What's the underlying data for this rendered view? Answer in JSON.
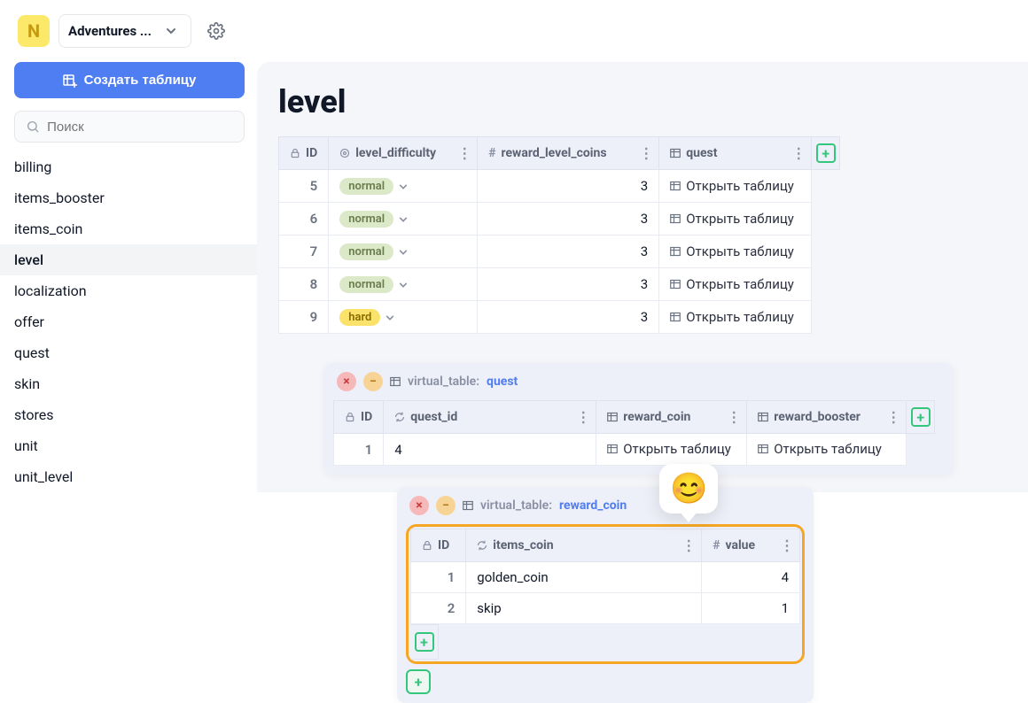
{
  "project_name": "Adventures ...",
  "create_button": "Создать таблицу",
  "search_placeholder": "Поиск",
  "sidebar_items": [
    "billing",
    "items_booster",
    "items_coin",
    "level",
    "localization",
    "offer",
    "quest",
    "skin",
    "stores",
    "unit",
    "unit_level"
  ],
  "active_sidebar": "level",
  "page_title": "level",
  "main_table": {
    "headers": {
      "id": "ID",
      "difficulty": "level_difficulty",
      "coins": "reward_level_coins",
      "quest": "quest"
    },
    "open_table_label": "Открыть таблицу",
    "rows": [
      {
        "id": "5",
        "difficulty": "normal",
        "diff_class": "normal",
        "coins": "3"
      },
      {
        "id": "6",
        "difficulty": "normal",
        "diff_class": "normal",
        "coins": "3"
      },
      {
        "id": "7",
        "difficulty": "normal",
        "diff_class": "normal",
        "coins": "3"
      },
      {
        "id": "8",
        "difficulty": "normal",
        "diff_class": "normal",
        "coins": "3"
      },
      {
        "id": "9",
        "difficulty": "hard",
        "diff_class": "hard",
        "coins": "3"
      }
    ]
  },
  "sub_quest": {
    "vt_prefix": "virtual_table:",
    "vt_name": "quest",
    "headers": {
      "id": "ID",
      "quest_id": "quest_id",
      "reward_coin": "reward_coin",
      "reward_booster": "reward_booster"
    },
    "open_table_label": "Открыть таблицу",
    "row": {
      "id": "1",
      "quest_id": "4"
    }
  },
  "sub_coin": {
    "vt_prefix": "virtual_table:",
    "vt_name": "reward_coin",
    "headers": {
      "id": "ID",
      "items_coin": "items_coin",
      "value": "value"
    },
    "rows": [
      {
        "id": "1",
        "item": "golden_coin",
        "value": "4"
      },
      {
        "id": "2",
        "item": "skip",
        "value": "1"
      }
    ]
  },
  "emoji": "😊"
}
